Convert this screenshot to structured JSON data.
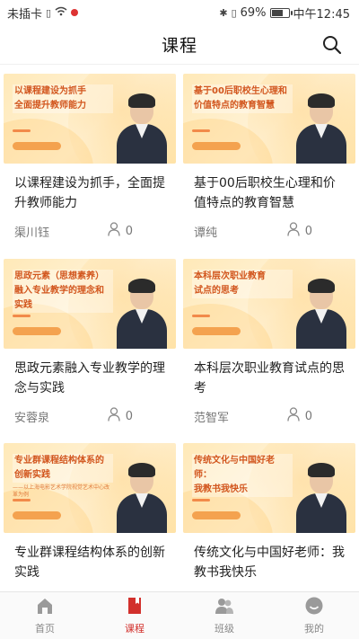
{
  "status_bar": {
    "carrier": "未插卡",
    "battery": "69%",
    "battery_level": 0.69,
    "time": "中午12:45"
  },
  "header": {
    "title": "课程"
  },
  "courses": [
    {
      "thumb_lines": [
        "以课程建设为抓手",
        "全面提升教师能力"
      ],
      "thumb_sub": "",
      "title": "以课程建设为抓手，全面提升教师能力",
      "lecturer": "渠川钰",
      "count": "0"
    },
    {
      "thumb_lines": [
        "基于00后职校生心理和",
        "价值特点的教育智慧"
      ],
      "thumb_sub": "",
      "title": "基于00后职校生心理和价值特点的教育智慧",
      "lecturer": "谭纯",
      "count": "0"
    },
    {
      "thumb_lines": [
        "思政元素（思想素养）",
        "融入专业教学的理念和实践"
      ],
      "thumb_sub": "",
      "title": "思政元素融入专业教学的理念与实践",
      "lecturer": "安蓉泉",
      "count": "0"
    },
    {
      "thumb_lines": [
        "本科层次职业教育",
        "试点的思考"
      ],
      "thumb_sub": "",
      "title": "本科层次职业教育试点的思考",
      "lecturer": "范智军",
      "count": "0"
    },
    {
      "thumb_lines": [
        "专业群课程结构体系的",
        "创新实践"
      ],
      "thumb_sub": "——以上海电影艺术学院视觉艺术中心改革为例",
      "title": "专业群课程结构体系的创新实践",
      "lecturer": "",
      "count": ""
    },
    {
      "thumb_lines": [
        "传统文化与中国好老师：",
        "我教书我快乐"
      ],
      "thumb_sub": "",
      "title": "传统文化与中国好老师：我教书我快乐",
      "lecturer": "",
      "count": ""
    }
  ],
  "tabs": [
    {
      "label": "首页",
      "icon": "home-icon",
      "active": false
    },
    {
      "label": "课程",
      "icon": "book-icon",
      "active": true
    },
    {
      "label": "班级",
      "icon": "class-icon",
      "active": false
    },
    {
      "label": "我的",
      "icon": "profile-icon",
      "active": false
    }
  ],
  "colors": {
    "accent": "#d2302c",
    "thumb_title": "#d2561e"
  }
}
